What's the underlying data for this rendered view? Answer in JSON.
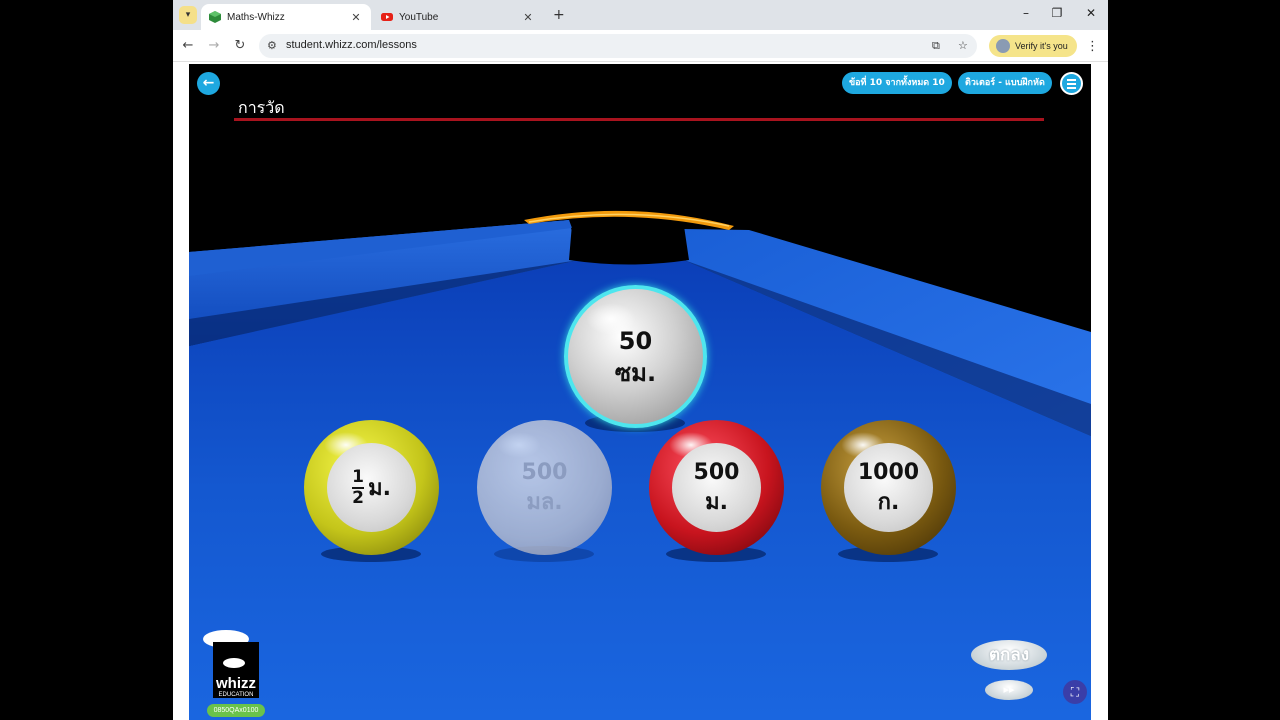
{
  "browser": {
    "tabs": [
      {
        "title": "Maths-Whizz",
        "active": true
      },
      {
        "title": "YouTube",
        "active": false
      }
    ],
    "url": "student.whizz.com/lessons",
    "profile_label": "Verify it's you"
  },
  "lesson": {
    "title": "การวัด",
    "progress_label": "ข้อที่ 10 จากทั้งหมด 10",
    "mode_label": "ติวเตอร์ - แบบฝึกหัด",
    "question_ball": {
      "value": "50",
      "unit": "ซม.",
      "color": "#c9c9c9"
    },
    "answer_balls": [
      {
        "frac_num": "1",
        "frac_den": "2",
        "unit": "ม.",
        "color": "#c4c51a"
      },
      {
        "value": "500",
        "unit": "มล.",
        "color": "#d8d8dc",
        "faded": true
      },
      {
        "value": "500",
        "unit": "ม.",
        "color": "#c8141e"
      },
      {
        "value": "1000",
        "unit": "ก.",
        "color": "#7a5a10"
      }
    ],
    "ok_label": "ตกลง",
    "skip_label": "▸▸",
    "logo_text": "whizz",
    "logo_sub": "EDUCATION",
    "code": "0850QAx0100"
  }
}
